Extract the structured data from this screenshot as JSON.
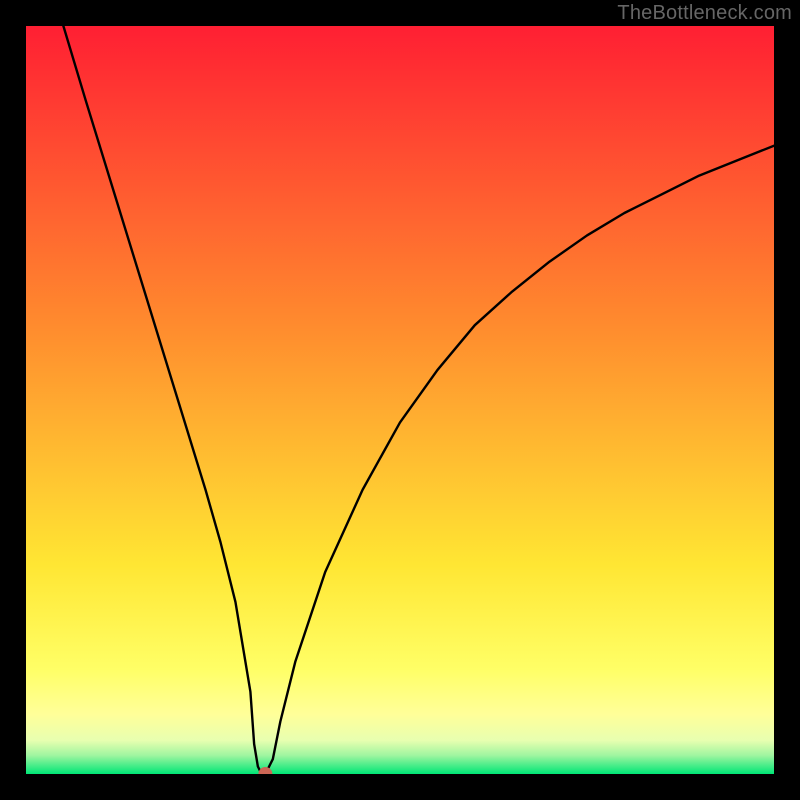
{
  "attribution": "TheBottleneck.com",
  "chart_data": {
    "type": "line",
    "title": "",
    "xlabel": "",
    "ylabel": "",
    "xlim": [
      0,
      100
    ],
    "ylim": [
      0,
      100
    ],
    "grid": false,
    "x": [
      5,
      8,
      12,
      16,
      20,
      24,
      26,
      28,
      30,
      30.5,
      31,
      31.5,
      32,
      33,
      34,
      36,
      40,
      45,
      50,
      55,
      60,
      65,
      70,
      75,
      80,
      85,
      90,
      95,
      100
    ],
    "values": [
      100,
      90,
      77,
      64,
      51,
      38,
      31,
      23,
      11,
      4,
      1,
      0,
      0,
      2,
      7,
      15,
      27,
      38,
      47,
      54,
      60,
      64.5,
      68.5,
      72,
      75,
      77.5,
      80,
      82,
      84
    ],
    "marker": {
      "x": 32,
      "y": 0,
      "color": "#cc6655",
      "radius_px": 7
    },
    "background_gradient": {
      "top": "#ff1f33",
      "mid1": "#ff8b2e",
      "mid2": "#ffe633",
      "band": "#ffff99",
      "bottom": "#00e676"
    }
  }
}
